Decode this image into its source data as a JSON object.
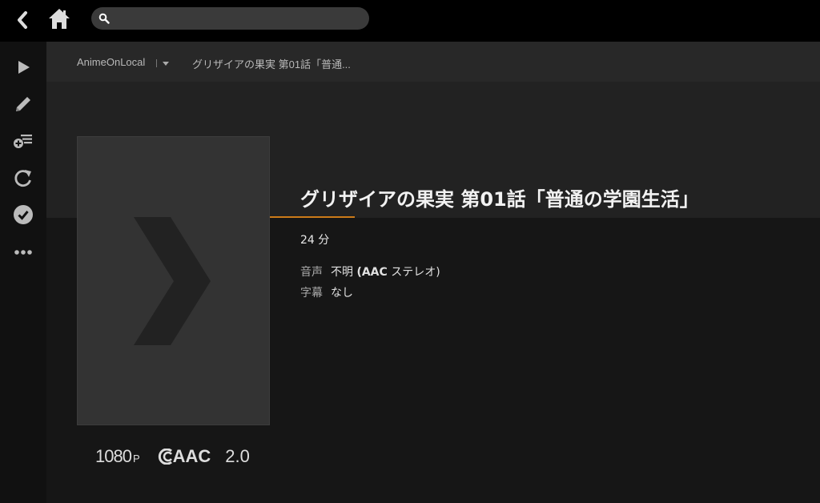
{
  "search": {
    "value": "",
    "placeholder": ""
  },
  "breadcrumb": {
    "library": "AnimeOnLocal",
    "current": "グリザイアの果実 第01話「普通..."
  },
  "episode": {
    "title": "グリザイアの果実 第01話「普通の学園生活」",
    "duration": "24 分",
    "audio_label": "音声",
    "audio_value_prefix": "不明 ",
    "audio_value_bold": "(AAC",
    "audio_value_suffix": " ステレオ)",
    "subtitle_label": "字幕",
    "subtitle_value": "なし"
  },
  "badges": {
    "resolution": "1080",
    "resolution_suffix": "P",
    "codec": "AAC",
    "channels": "2.0"
  },
  "icons": {
    "back": "chevron-left-icon",
    "home": "home-icon",
    "search": "search-icon",
    "play": "play-icon",
    "edit": "pencil-icon",
    "add_to_playlist": "add-to-playlist-icon",
    "refresh": "refresh-icon",
    "mark_watched": "check-circle-icon",
    "more": "more-dots-icon"
  },
  "colors": {
    "accent": "#cc7b19",
    "topbar": "#000000",
    "sidebar": "#111111",
    "background": "#1f1f1f"
  }
}
